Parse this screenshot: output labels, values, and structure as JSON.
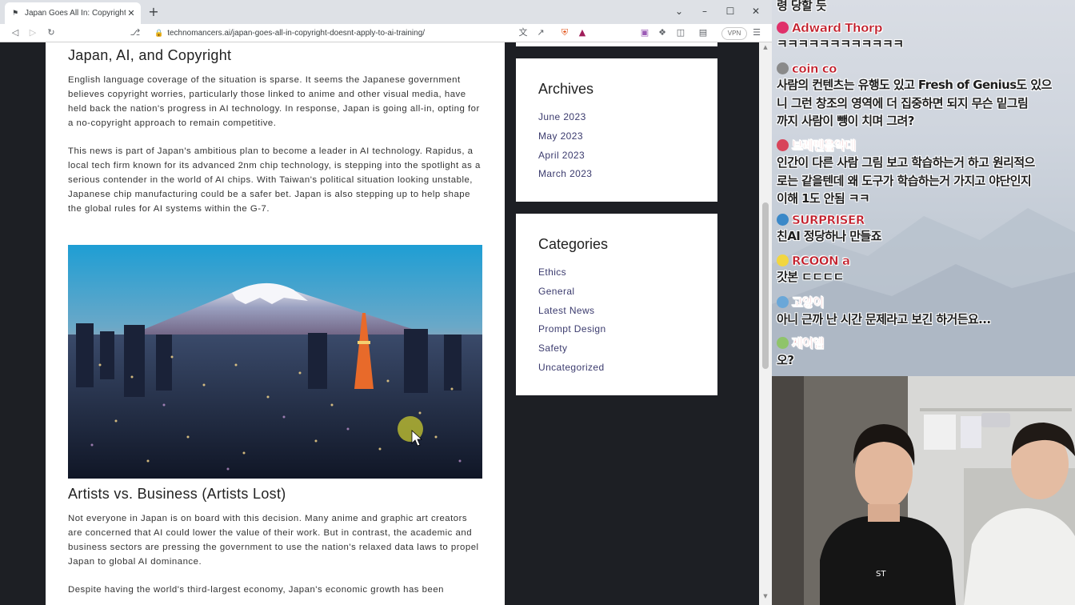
{
  "browser": {
    "tab_title": "Japan Goes All In: Copyright Doe",
    "url": "technomancers.ai/japan-goes-all-in-copyright-doesnt-apply-to-ai-training/",
    "vpn_label": "VPN"
  },
  "article": {
    "heading1": "Japan, AI, and Copyright",
    "para1": "English language coverage of the situation is sparse. It seems the Japanese government believes copyright worries, particularly those linked to anime and other visual media, have held back the nation's progress in AI technology. In response, Japan is going all-in, opting for a no-copyright approach to remain competitive.",
    "para2": "This news is part of Japan's ambitious plan to become a leader in AI technology. Rapidus, a local tech firm known for its advanced 2nm chip technology, is stepping into the spotlight as a serious contender in the world of AI chips. With Taiwan's political situation looking unstable, Japanese chip manufacturing could be a safer bet. Japan is also stepping up to help shape the global rules for AI systems within the G-7.",
    "heading2": "Artists vs. Business (Artists Lost)",
    "para3": "Not everyone in Japan is on board with this decision. Many anime and graphic art creators are concerned that AI could lower the value of their work. But in contrast, the academic and business sectors are pressing the government to use the nation's relaxed data laws to propel Japan to global AI dominance.",
    "para4": "Despite having the world's third-largest economy, Japan's economic growth has been"
  },
  "sidebar": {
    "archives_title": "Archives",
    "archives": [
      "June 2023",
      "May 2023",
      "April 2023",
      "March 2023"
    ],
    "categories_title": "Categories",
    "categories": [
      "Ethics",
      "General",
      "Latest News",
      "Prompt Design",
      "Safety",
      "Uncategorized"
    ]
  },
  "chat": {
    "top_line": "령 당할 듯",
    "messages": [
      {
        "user": "Adward Thorp",
        "lines": [
          "ㅋㅋㅋㅋㅋㅋㅋㅋㅋㅋㅋㅋ"
        ],
        "badge_color": "#e0306a"
      },
      {
        "user": "coin co",
        "lines": [
          "사람의 컨텐츠는 유행도 있고 Fresh of Genius도 있으",
          "니 그런 창조의 영역에 더 집중하면 되지 무슨 밑그림",
          "까지 사람이 뺑이 치며 그려?"
        ],
        "badge_color": "#8a8a8a"
      },
      {
        "user": "브레멘음악대",
        "lines": [
          "인간이 다른 사람 그림 보고 학습하는거 하고 원리적으",
          "로는 같을텐데 왜 도구가 학습하는거 가지고 야단인지",
          "이해 1도 안됨 ㅋㅋ"
        ],
        "badge_color": "#d8455a"
      },
      {
        "user": "SURPRISER",
        "lines": [
          "친AI 정당하나 만들죠"
        ],
        "badge_color": "#3a88c8"
      },
      {
        "user": "RCOON a",
        "lines": [
          "갓본 ㄷㄷㄷㄷ"
        ],
        "badge_color": "#f2d640"
      },
      {
        "user": "고양이",
        "lines": [
          "아니 근까 난 시간 문제라고 보긴 하거든요..."
        ],
        "badge_color": "#6aa7d8"
      },
      {
        "user": "제이엠",
        "lines": [
          "오?"
        ],
        "badge_color": "#8fc46a"
      }
    ]
  }
}
